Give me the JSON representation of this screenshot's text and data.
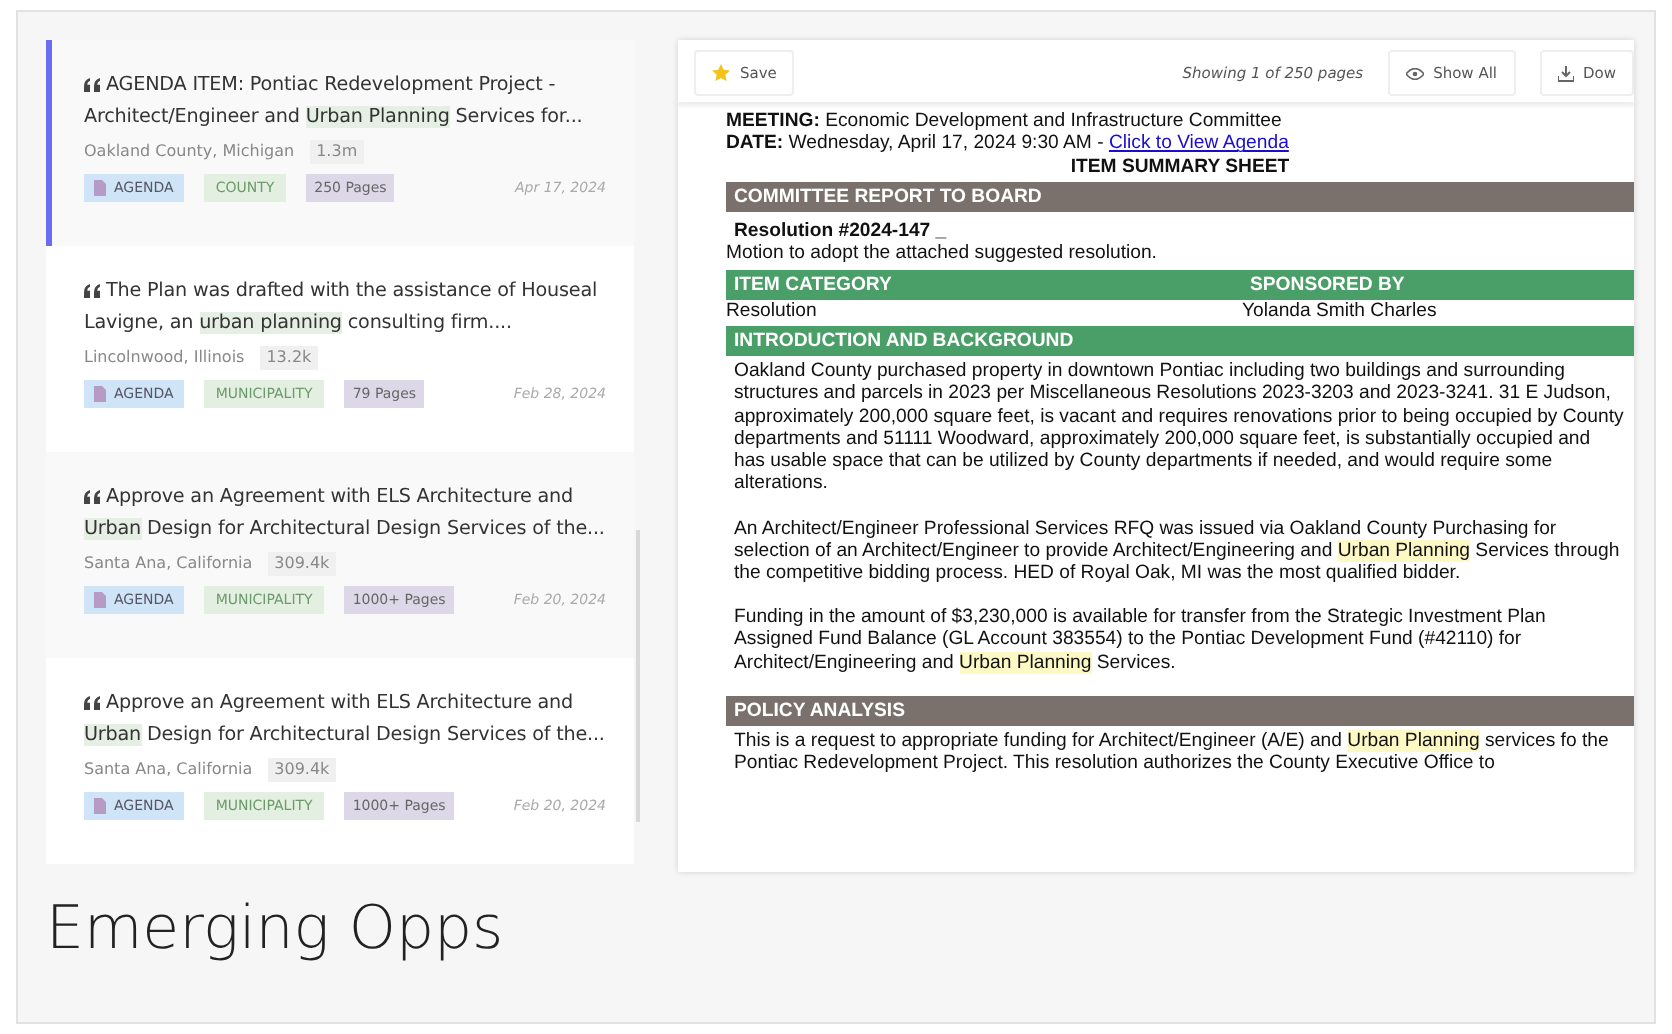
{
  "results": [
    {
      "selected": true,
      "snippet": [
        {
          "text": "AGENDA ITEM: Pontiac Redevelopment Project - Architect/Engineer and ",
          "highlight": false
        },
        {
          "text": "Urban Planning",
          "highlight": true
        },
        {
          "text": " Services for...",
          "highlight": false
        }
      ],
      "location": "Oakland County, Michigan",
      "views": "1.3m",
      "doc_type": "AGENDA",
      "jurisdiction": "COUNTY",
      "pages": "250 Pages",
      "date": "Apr 17, 2024"
    },
    {
      "selected": false,
      "snippet": [
        {
          "text": "The Plan was drafted with the assistance of Houseal Lavigne, an ",
          "highlight": false
        },
        {
          "text": "urban planning",
          "highlight": true
        },
        {
          "text": " consulting firm....",
          "highlight": false
        }
      ],
      "location": "Lincolnwood, Illinois",
      "views": "13.2k",
      "doc_type": "AGENDA",
      "jurisdiction": "MUNICIPALITY",
      "pages": "79 Pages",
      "date": "Feb 28, 2024"
    },
    {
      "selected": false,
      "snippet": [
        {
          "text": "Approve an Agreement with ELS Architecture and ",
          "highlight": false
        },
        {
          "text": "Urban",
          "highlight": true
        },
        {
          "text": " Design for Architectural Design Services of the...",
          "highlight": false
        }
      ],
      "location": "Santa Ana, California",
      "views": "309.4k",
      "doc_type": "AGENDA",
      "jurisdiction": "MUNICIPALITY",
      "pages": "1000+ Pages",
      "date": "Feb 20, 2024"
    },
    {
      "selected": false,
      "snippet": [
        {
          "text": "Approve an Agreement with ELS Architecture and ",
          "highlight": false
        },
        {
          "text": "Urban",
          "highlight": true
        },
        {
          "text": " Design for Architectural Design Services of the...",
          "highlight": false
        }
      ],
      "location": "Santa Ana, California",
      "views": "309.4k",
      "doc_type": "AGENDA",
      "jurisdiction": "MUNICIPALITY",
      "pages": "1000+ Pages",
      "date": "Feb 20, 2024"
    }
  ],
  "viewer": {
    "toolbar": {
      "save": "Save",
      "page_status": "Showing 1 of 250 pages",
      "show_all": "Show All",
      "download": "Dow"
    },
    "document": {
      "meeting": "**MEETING:** Economic Development and Infrastructure Committee",
      "date": "**DATE:** Wednesday, April 17, 2024 9:30 AM - ",
      "agenda_link": "Click to View Agenda",
      "heading": "ITEM SUMMARY SHEET",
      "blocks": [
        {
          "kind": "bar",
          "text": "COMMITTEE REPORT TO BOARD",
          "color": "#7a716c"
        },
        {
          "kind": "resolution",
          "title": "Resolution #2024-147 _",
          "text": "Motion to adopt the attached suggested resolution."
        },
        {
          "kind": "table",
          "headers": [
            "ITEM CATEGORY",
            "SPONSORED BY"
          ],
          "cells": [
            "Resolution",
            "Yolanda Smith Charles"
          ],
          "color": "#4a9e68"
        },
        {
          "kind": "bar",
          "text": "INTRODUCTION AND BACKGROUND",
          "color": "#4a9e68"
        },
        {
          "kind": "paragraph",
          "parts": [
            {
              "text": "Oakland County purchased property in downtown Pontiac including two buildings and surrounding structures and parcels in 2023 per Miscellaneous Resolutions 2023-3203 and 2023-3241. 31 E Judson, approximately 200,000 square feet, is vacant and requires renovations prior to being occupied by County departments and 51111 Woodward, approximately 200,000 square feet, is substantially occupied and has usable space that can be utilized by County departments if needed, and would require some alterations.",
              "highlight": false
            }
          ]
        },
        {
          "kind": "paragraph",
          "parts": [
            {
              "text": "An Architect/Engineer Professional Services RFQ was issued via Oakland County Purchasing for selection of an Architect/Engineer to provide Architect/Engineering and ",
              "highlight": false
            },
            {
              "text": "Urban Planning",
              "highlight": true
            },
            {
              "text": " Services through the competitive bidding process. HED of Royal Oak, MI was the most qualified bidder.",
              "highlight": false
            }
          ]
        },
        {
          "kind": "paragraph",
          "parts": [
            {
              "text": "Funding in the amount of $3,230,000 is available for transfer from the Strategic Investment Plan Assigned Fund Balance (GL Account 383554) to the Pontiac Development Fund (#42110) for Architect/Engineering and ",
              "highlight": false
            },
            {
              "text": "Urban Planning",
              "highlight": true
            },
            {
              "text": " Services.",
              "highlight": false
            }
          ]
        },
        {
          "kind": "bar",
          "text": "POLICY ANALYSIS",
          "color": "#7a716c"
        },
        {
          "kind": "paragraph",
          "parts": [
            {
              "text": "This is a request to appropriate funding for Architect/Engineer (A/E) and ",
              "highlight": false
            },
            {
              "text": "Urban Planning",
              "highlight": true
            },
            {
              "text": " services fo",
              "highlight": false
            },
            {
              "text": " the Pontiac Redevelopment Project. This resolution authorizes the County Executive Office to",
              "highlight": false
            }
          ]
        }
      ]
    }
  },
  "footer": {
    "title": "Emerging Opps"
  }
}
